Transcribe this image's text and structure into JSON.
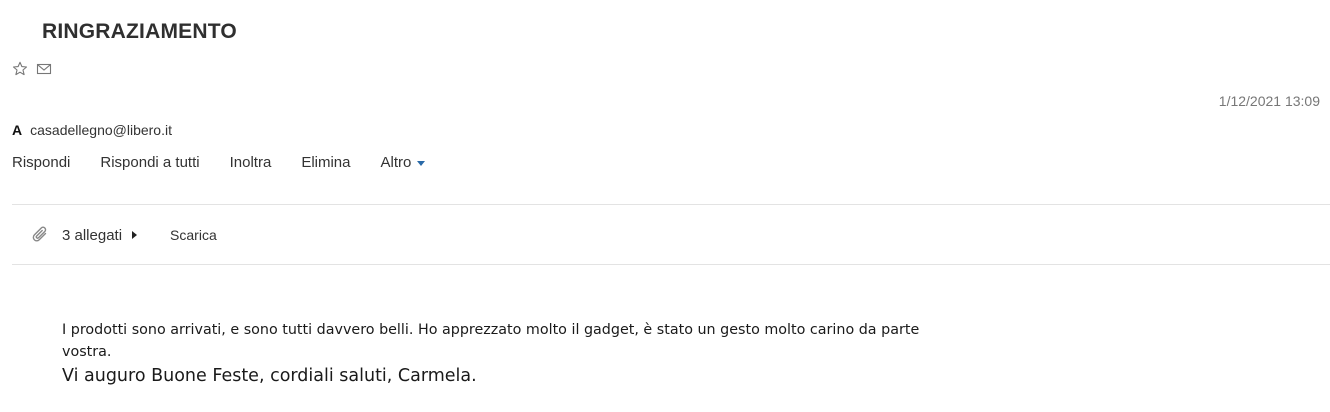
{
  "message": {
    "subject": "RINGRAZIAMENTO",
    "date": "1/12/2021 13:09",
    "to_label": "A",
    "to_address": "casadellegno@libero.it"
  },
  "icons": {
    "star": "star-outline-icon",
    "envelope": "envelope-icon",
    "paperclip": "paperclip-icon",
    "dropdown": "caret-down-icon",
    "expand": "caret-right-icon"
  },
  "actions": {
    "reply": "Rispondi",
    "reply_all": "Rispondi a tutti",
    "forward": "Inoltra",
    "delete": "Elimina",
    "more": "Altro"
  },
  "attachments": {
    "count_label": "3 allegati",
    "download_label": "Scarica"
  },
  "body": {
    "paragraph_1": "I prodotti sono arrivati, e sono tutti davvero belli. Ho apprezzato molto il gadget, è stato un gesto molto carino da parte vostra.",
    "paragraph_2": "Vi auguro Buone Feste, cordiali saluti, Carmela."
  },
  "colors": {
    "accent": "#2a6aa8",
    "text": "#333333",
    "muted": "#777777",
    "divider": "#e3e3e3"
  }
}
